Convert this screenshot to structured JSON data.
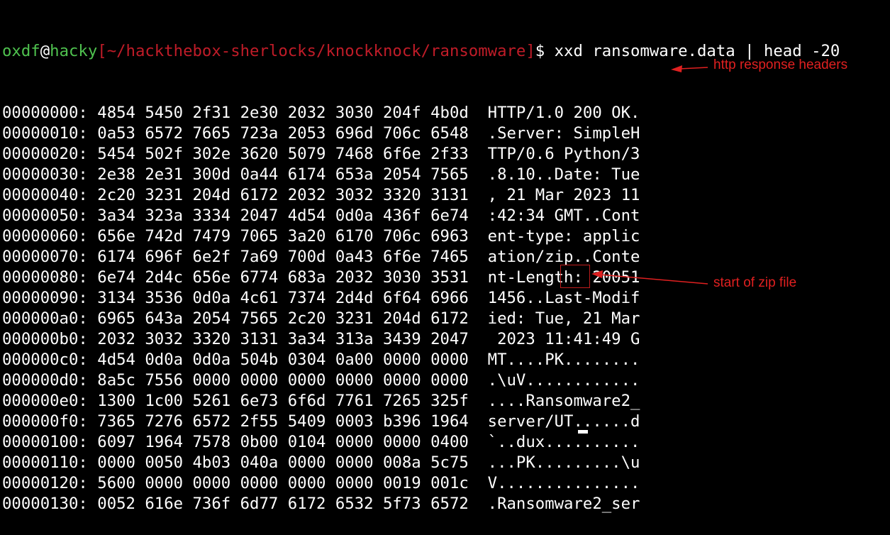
{
  "prompt": {
    "user": "oxdf",
    "at": "@",
    "host": "hacky",
    "path": "[~/hackthebox-sherlocks/knockknock/ransomware]",
    "dollar": "$",
    "command": " xxd ransomware.data | head -20"
  },
  "rows": [
    {
      "offset": "00000000:",
      "hex": "4854 5450 2f31 2e30 2032 3030 204f 4b0d",
      "ascii": "HTTP/1.0 200 OK."
    },
    {
      "offset": "00000010:",
      "hex": "0a53 6572 7665 723a 2053 696d 706c 6548",
      "ascii": ".Server: SimpleH"
    },
    {
      "offset": "00000020:",
      "hex": "5454 502f 302e 3620 5079 7468 6f6e 2f33",
      "ascii": "TTP/0.6 Python/3"
    },
    {
      "offset": "00000030:",
      "hex": "2e38 2e31 300d 0a44 6174 653a 2054 7565",
      "ascii": ".8.10..Date: Tue"
    },
    {
      "offset": "00000040:",
      "hex": "2c20 3231 204d 6172 2032 3032 3320 3131",
      "ascii": ", 21 Mar 2023 11"
    },
    {
      "offset": "00000050:",
      "hex": "3a34 323a 3334 2047 4d54 0d0a 436f 6e74",
      "ascii": ":42:34 GMT..Cont"
    },
    {
      "offset": "00000060:",
      "hex": "656e 742d 7479 7065 3a20 6170 706c 6963",
      "ascii": "ent-type: applic"
    },
    {
      "offset": "00000070:",
      "hex": "6174 696f 6e2f 7a69 700d 0a43 6f6e 7465",
      "ascii": "ation/zip..Conte"
    },
    {
      "offset": "00000080:",
      "hex": "6e74 2d4c 656e 6774 683a 2032 3030 3531",
      "ascii": "nt-Length: 20051"
    },
    {
      "offset": "00000090:",
      "hex": "3134 3536 0d0a 4c61 7374 2d4d 6f64 6966",
      "ascii": "1456..Last-Modif"
    },
    {
      "offset": "000000a0:",
      "hex": "6965 643a 2054 7565 2c20 3231 204d 6172",
      "ascii": "ied: Tue, 21 Mar"
    },
    {
      "offset": "000000b0:",
      "hex": "2032 3032 3320 3131 3a34 313a 3439 2047",
      "ascii": " 2023 11:41:49 G"
    },
    {
      "offset": "000000c0:",
      "hex": "4d54 0d0a 0d0a 504b 0304 0a00 0000 0000",
      "ascii": "MT....PK........"
    },
    {
      "offset": "000000d0:",
      "hex": "8a5c 7556 0000 0000 0000 0000 0000 0000",
      "ascii": ".\\uV............"
    },
    {
      "offset": "000000e0:",
      "hex": "1300 1c00 5261 6e73 6f6d 7761 7265 325f",
      "ascii": "....Ransomware2_"
    },
    {
      "offset": "000000f0:",
      "hex": "7365 7276 6572 2f55 5409 0003 b396 1964",
      "ascii": "server/UT......d"
    },
    {
      "offset": "00000100:",
      "hex": "6097 1964 7578 0b00 0104 0000 0000 0400",
      "ascii": "`..dux.........."
    },
    {
      "offset": "00000110:",
      "hex": "0000 0050 4b03 040a 0000 0000 008a 5c75",
      "ascii": "...PK.........\\u"
    },
    {
      "offset": "00000120:",
      "hex": "5600 0000 0000 0000 0000 0000 0019 001c",
      "ascii": "V..............."
    },
    {
      "offset": "00000130:",
      "hex": "0052 616e 736f 6d77 6172 6532 5f73 6572",
      "ascii": ".Ransomware2_ser"
    }
  ],
  "annotations": {
    "http_headers": "http response headers",
    "zip_start": "start of zip file"
  },
  "colors": {
    "background": "#000000",
    "text": "#ffffff",
    "prompt_green": "#4fc24f",
    "prompt_path_red": "#c01c28",
    "annotation_red": "#e02020"
  }
}
